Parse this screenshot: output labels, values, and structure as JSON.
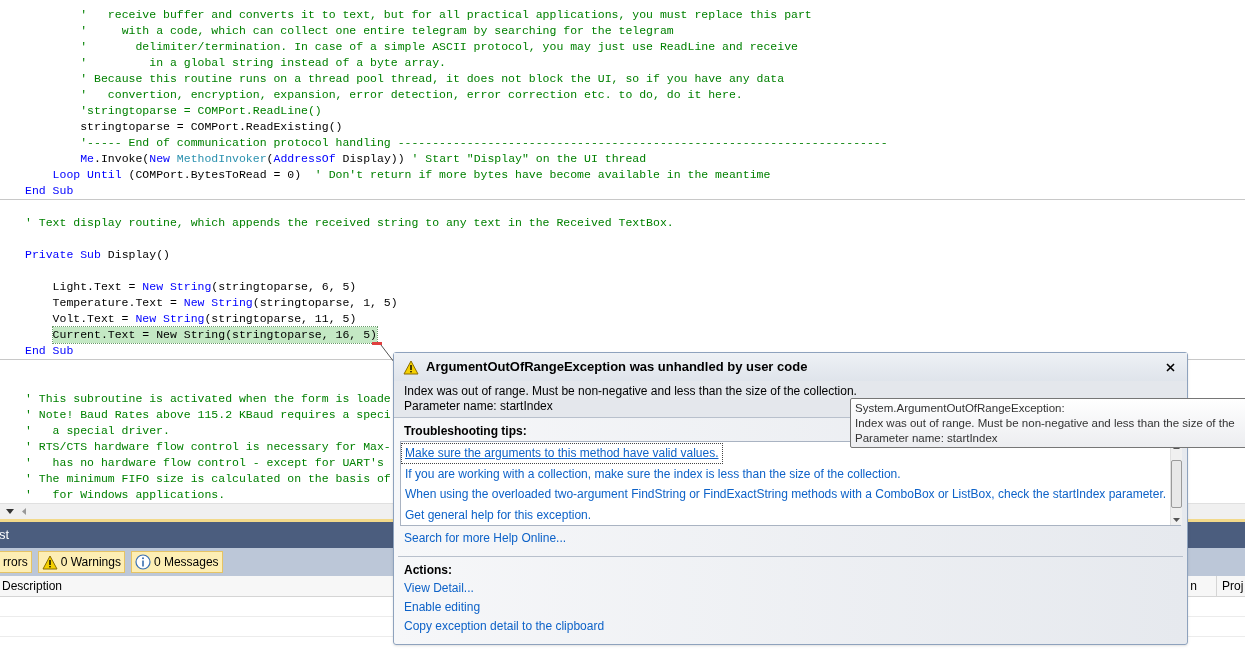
{
  "editor": {
    "lines": [
      {
        "kind": "code",
        "highlighted": false,
        "tokens": [
          {
            "kind": "comment",
            "text": "        '   receive buffer and converts it to text, but for all practical applications, you must replace this part"
          }
        ]
      },
      {
        "kind": "code",
        "highlighted": false,
        "tokens": [
          {
            "kind": "comment",
            "text": "        '     with a code, which can collect one entire telegram by searching for the telegram"
          }
        ]
      },
      {
        "kind": "code",
        "highlighted": false,
        "tokens": [
          {
            "kind": "comment",
            "text": "        '       delimiter/termination. In case of a simple ASCII protocol, you may just use ReadLine and receive"
          }
        ]
      },
      {
        "kind": "code",
        "highlighted": false,
        "tokens": [
          {
            "kind": "comment",
            "text": "        '         in a global string instead of a byte array."
          }
        ]
      },
      {
        "kind": "code",
        "highlighted": false,
        "tokens": [
          {
            "kind": "comment",
            "text": "        ' Because this routine runs on a thread pool thread, it does not block the UI, so if you have any data"
          }
        ]
      },
      {
        "kind": "code",
        "highlighted": false,
        "tokens": [
          {
            "kind": "comment",
            "text": "        '   convertion, encryption, expansion, error detection, error correction etc. to do, do it here."
          }
        ]
      },
      {
        "kind": "code",
        "highlighted": false,
        "tokens": [
          {
            "kind": "comment",
            "text": "        'stringtoparse = COMPort.ReadLine()"
          }
        ]
      },
      {
        "kind": "code",
        "highlighted": false,
        "tokens": [
          {
            "kind": "plain",
            "text": "        stringtoparse = COMPort.ReadExisting()"
          }
        ]
      },
      {
        "kind": "code",
        "highlighted": false,
        "tokens": [
          {
            "kind": "comment",
            "text": "        '----- End of communication protocol handling -----------------------------------------------------------------------"
          }
        ]
      },
      {
        "kind": "code",
        "highlighted": false,
        "tokens": [
          {
            "kind": "keyword",
            "text": "        Me"
          },
          {
            "kind": "plain",
            "text": ".Invoke("
          },
          {
            "kind": "keyword",
            "text": "New "
          },
          {
            "kind": "type",
            "text": "MethodInvoker"
          },
          {
            "kind": "plain",
            "text": "("
          },
          {
            "kind": "keyword",
            "text": "AddressOf"
          },
          {
            "kind": "plain",
            "text": " Display)) "
          },
          {
            "kind": "comment",
            "text": "' Start \"Display\" on the UI thread"
          }
        ]
      },
      {
        "kind": "code",
        "highlighted": false,
        "tokens": [
          {
            "kind": "keyword",
            "text": "    Loop Until"
          },
          {
            "kind": "plain",
            "text": " (COMPort.BytesToRead = 0)  "
          },
          {
            "kind": "comment",
            "text": "' Don't return if more bytes have become available in the meantime"
          }
        ]
      },
      {
        "kind": "code",
        "highlighted": false,
        "tokens": [
          {
            "kind": "keyword",
            "text": "End Sub"
          }
        ]
      },
      {
        "kind": "rule"
      },
      {
        "kind": "blank"
      },
      {
        "kind": "code",
        "highlighted": false,
        "tokens": [
          {
            "kind": "comment",
            "text": "' Text display routine, which appends the received string to any text in the Received TextBox."
          }
        ]
      },
      {
        "kind": "blank"
      },
      {
        "kind": "code",
        "highlighted": false,
        "tokens": [
          {
            "kind": "keyword",
            "text": "Private Sub"
          },
          {
            "kind": "plain",
            "text": " Display()"
          }
        ]
      },
      {
        "kind": "blank"
      },
      {
        "kind": "code",
        "highlighted": false,
        "tokens": [
          {
            "kind": "plain",
            "text": "    Light.Text = "
          },
          {
            "kind": "keyword",
            "text": "New String"
          },
          {
            "kind": "plain",
            "text": "(stringtoparse, 6, 5)"
          }
        ]
      },
      {
        "kind": "code",
        "highlighted": false,
        "tokens": [
          {
            "kind": "plain",
            "text": "    Temperature.Text = "
          },
          {
            "kind": "keyword",
            "text": "New String"
          },
          {
            "kind": "plain",
            "text": "(stringtoparse, 1, 5)"
          }
        ]
      },
      {
        "kind": "code",
        "highlighted": false,
        "tokens": [
          {
            "kind": "plain",
            "text": "    Volt.Text = "
          },
          {
            "kind": "keyword",
            "text": "New String"
          },
          {
            "kind": "plain",
            "text": "(stringtoparse, 11, 5)"
          }
        ]
      },
      {
        "kind": "code",
        "highlighted": true,
        "tokens": [
          {
            "kind": "plain",
            "text": "    Current.Text = New String(stringtoparse, 16, 5)"
          }
        ]
      },
      {
        "kind": "code",
        "highlighted": false,
        "tokens": [
          {
            "kind": "keyword",
            "text": "End Sub"
          }
        ]
      },
      {
        "kind": "rule"
      },
      {
        "kind": "blank"
      },
      {
        "kind": "blank"
      },
      {
        "kind": "code",
        "highlighted": false,
        "tokens": [
          {
            "kind": "comment",
            "text": "' This subroutine is activated when the form is loade"
          }
        ]
      },
      {
        "kind": "code",
        "highlighted": false,
        "tokens": [
          {
            "kind": "comment",
            "text": "' Note! Baud Rates above 115.2 KBaud requires a speci"
          }
        ]
      },
      {
        "kind": "code",
        "highlighted": false,
        "tokens": [
          {
            "kind": "comment",
            "text": "'   a special driver."
          }
        ]
      },
      {
        "kind": "code",
        "highlighted": false,
        "tokens": [
          {
            "kind": "comment",
            "text": "' RTS/CTS hardware flow control is necessary for Max-"
          }
        ]
      },
      {
        "kind": "code",
        "highlighted": false,
        "tokens": [
          {
            "kind": "comment",
            "text": "'   has no hardware flow control - except for UART's"
          }
        ]
      },
      {
        "kind": "code",
        "highlighted": false,
        "tokens": [
          {
            "kind": "comment",
            "text": "' The minimum FIFO size is calculated on the basis of"
          }
        ]
      },
      {
        "kind": "code",
        "highlighted": false,
        "tokens": [
          {
            "kind": "comment",
            "text": "'   for Windows applications."
          }
        ]
      }
    ]
  },
  "error_list": {
    "title": "st",
    "filters": [
      {
        "label": "rrors",
        "selected": true
      },
      {
        "label": "0 Warnings",
        "selected": true
      },
      {
        "label": "0 Messages",
        "selected": true
      }
    ],
    "columns": [
      "Description",
      "n",
      "Proj"
    ]
  },
  "exception_dialog": {
    "title": "ArgumentOutOfRangeException was unhandled by user code",
    "message": [
      "Index was out of range. Must be non-negative and less than the size of the collection.",
      "Parameter name: startIndex"
    ],
    "tips_heading": "Troubleshooting tips:",
    "tips": [
      {
        "text": "Make sure the arguments to this method have valid values.",
        "selected": true
      },
      {
        "text": "If you are working with a collection, make sure the index is less than the size of the collection.",
        "selected": false
      },
      {
        "text": "When using the overloaded two-argument FindString or FindExactString methods with a ComboBox or ListBox, check the startIndex parameter.",
        "selected": false
      },
      {
        "text": "Get general help for this exception.",
        "selected": false
      }
    ],
    "help_link": "Search for more Help Online...",
    "actions_heading": "Actions:",
    "actions": [
      "View Detail...",
      "Enable editing",
      "Copy exception detail to the clipboard"
    ]
  },
  "tooltip": {
    "lines": [
      "System.ArgumentOutOfRangeException:",
      "Index was out of range. Must be non-negative and less than the size of the",
      "Parameter name: startIndex"
    ]
  }
}
